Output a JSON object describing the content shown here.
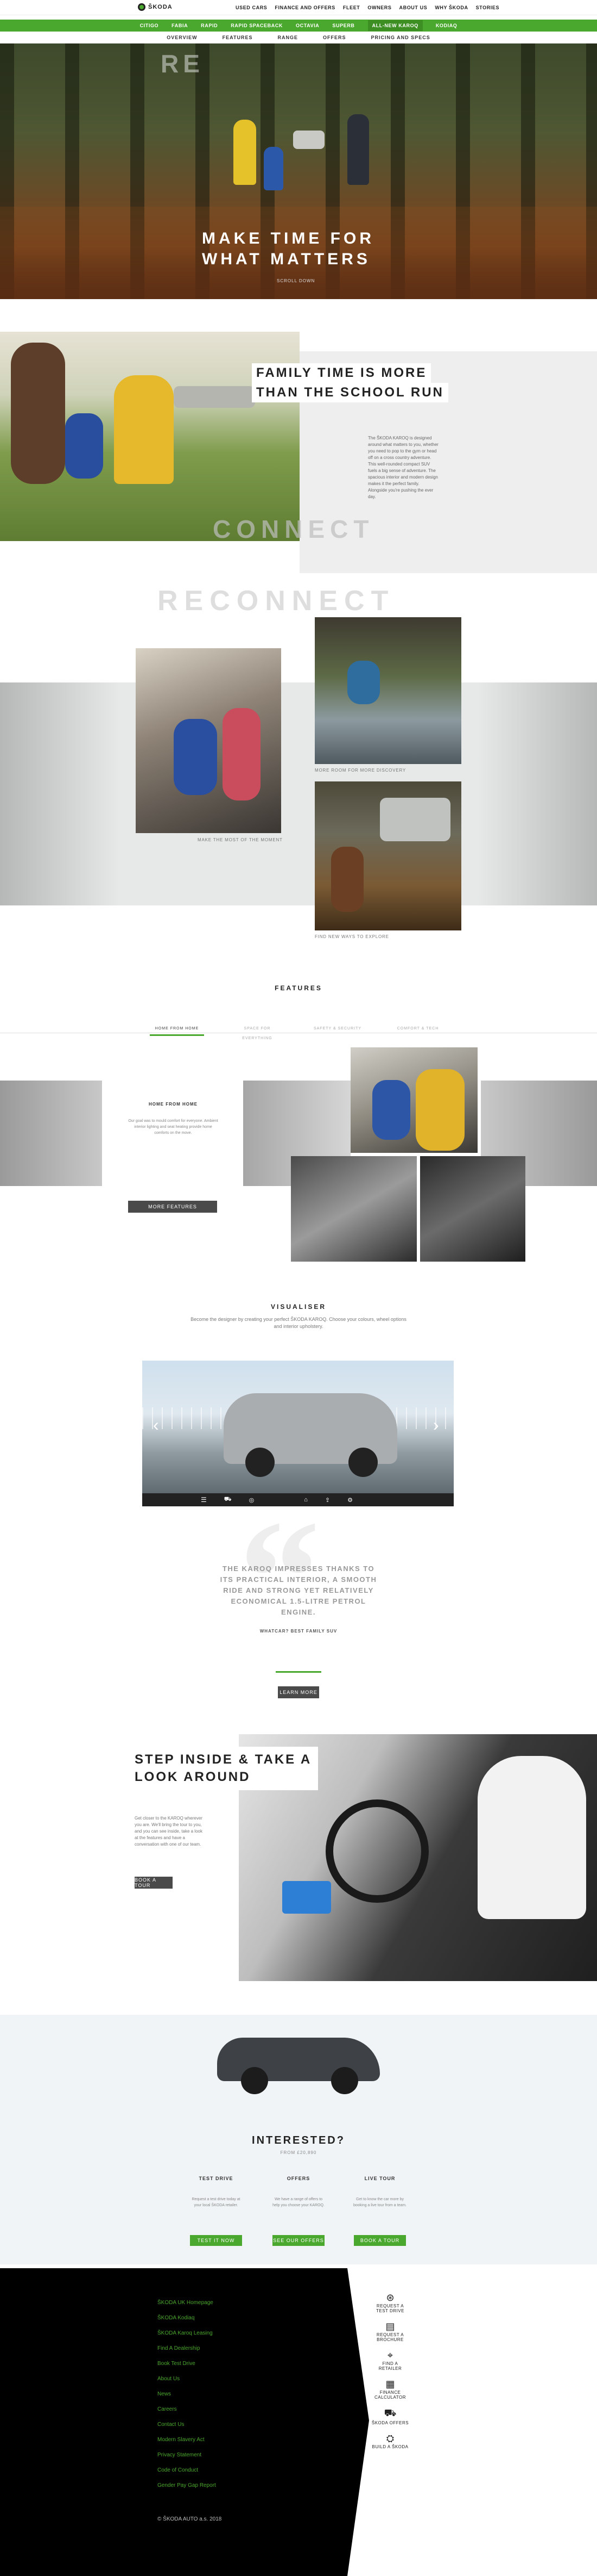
{
  "header": {
    "brand": "ŠKODA",
    "top_links": [
      "USED CARS",
      "FINANCE AND OFFERS",
      "FLEET",
      "OWNERS",
      "ABOUT US",
      "WHY ŠKODA",
      "STORIES"
    ]
  },
  "model_nav": [
    "CITIGO",
    "FABIA",
    "RAPID",
    "RAPID SPACEBACK",
    "OCTAVIA",
    "SUPERB",
    "ALL-NEW KAROQ",
    "KODIAQ"
  ],
  "active_model_index": 6,
  "sub_nav": [
    "OVERVIEW",
    "FEATURES",
    "RANGE",
    "OFFERS",
    "PRICING AND SPECS"
  ],
  "hero": {
    "line1": "MAKE TIME FOR",
    "line2": "WHAT MATTERS",
    "watermark": "RE",
    "scroll_label": "SCROLL DOWN"
  },
  "family": {
    "title_line1": "FAMILY TIME IS MORE",
    "title_line2": "THAN THE SCHOOL RUN",
    "body": "The ŠKODA KAROQ is designed around what matters to you, whether you need to pop to the gym or head off on a cross country adventure. This well-rounded compact SUV fuels a big sense of adventure. The spacious interior and modern design makes it the perfect family. Alongside you're pushing the ever day.",
    "watermark": "CONNECT"
  },
  "reconnect": {
    "watermark": "RECONNECT",
    "captions": [
      "MAKE THE MOST OF THE MOMENT",
      "MORE ROOM FOR MORE DISCOVERY",
      "FIND NEW WAYS TO EXPLORE"
    ]
  },
  "features": {
    "heading": "FEATURES",
    "tabs": [
      "HOME FROM HOME",
      "SPACE FOR EVERYTHING",
      "SAFETY & SECURITY",
      "COMFORT & TECH"
    ],
    "active_tab_index": 0,
    "panel_title": "HOME FROM HOME",
    "panel_body": "Our goal was to mould comfort for everyone. Ambient interior lighting and seat heating provide home comforts on the move.",
    "button": "MORE FEATURES"
  },
  "visualiser": {
    "heading": "VISUALISER",
    "body": "Become the designer by creating your perfect ŠKODA KAROQ. Choose your colours, wheel options and interior upholstery.",
    "prev_icon": "‹",
    "next_icon": "›"
  },
  "quote": {
    "mark": "“",
    "text": "THE KAROQ IMPRESSES THANKS TO ITS PRACTICAL INTERIOR, A SMOOTH RIDE AND STRONG YET RELATIVELY ECONOMICAL 1.5-LITRE PETROL ENGINE.",
    "source": "WHATCAR? BEST FAMILY SUV",
    "button": "LEARN MORE"
  },
  "step_inside": {
    "title_line1": "STEP INSIDE & TAKE A",
    "title_line2": "LOOK AROUND",
    "body": "Get closer to the KAROQ wherever you are. We'll bring the tour to you, and you can see inside, take a look at the features and have a conversation with one of our team.",
    "button": "BOOK A TOUR"
  },
  "interested": {
    "heading": "INTERESTED?",
    "price": "FROM £20,890",
    "cols": [
      {
        "title": "TEST DRIVE",
        "body": "Request a test drive today at your local ŠKODA retailer.",
        "button": "TEST IT NOW"
      },
      {
        "title": "OFFERS",
        "body": "We have a range of offers to help you choose your KAROQ.",
        "button": "SEE OUR OFFERS"
      },
      {
        "title": "LIVE TOUR",
        "body": "Get to know the car more by booking a live tour from a team.",
        "button": "BOOK A TOUR"
      }
    ]
  },
  "footer": {
    "links": [
      "ŠKODA UK Homepage",
      "ŠKODA Kodiaq",
      "ŠKODA Karoq Leasing",
      "Find A Dealership",
      "Book Test Drive",
      "About Us",
      "News",
      "Careers",
      "Contact Us",
      "Modern Slavery Act",
      "Privacy Statement",
      "Code of Conduct",
      "Gender Pay Gap Report"
    ],
    "copyright": "© ŠKODA AUTO a.s. 2018",
    "icons": [
      {
        "icon": "steering-wheel-icon",
        "label": "REQUEST A TEST DRIVE"
      },
      {
        "icon": "brochure-icon",
        "label": "REQUEST A BROCHURE"
      },
      {
        "icon": "location-pin-icon",
        "label": "FIND A RETAILER"
      },
      {
        "icon": "calculator-icon",
        "label": "FINANCE CALCULATOR"
      },
      {
        "icon": "car-icon",
        "label": "ŠKODA OFFERS"
      },
      {
        "icon": "car-build-icon",
        "label": "BUILD A ŠKODA"
      }
    ]
  }
}
